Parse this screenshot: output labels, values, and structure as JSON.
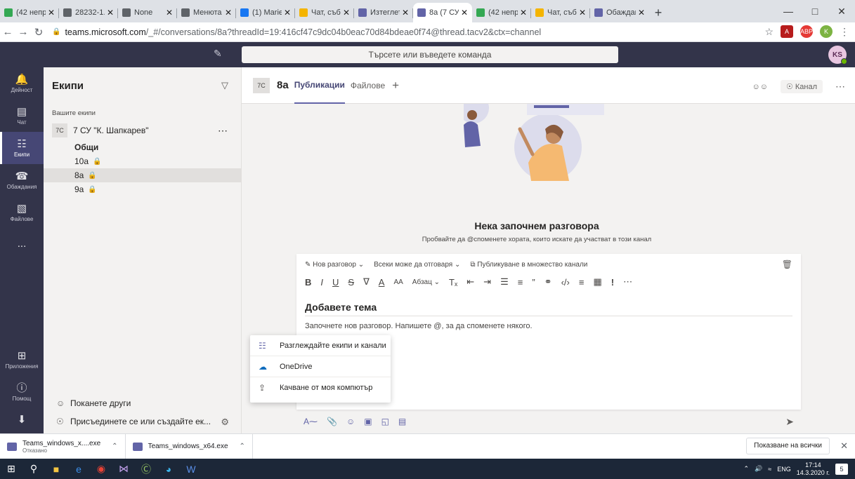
{
  "browser": {
    "tabs": [
      {
        "title": "(42 непро",
        "favicon": "#34a853"
      },
      {
        "title": "28232-1.p",
        "favicon": "#5f6368"
      },
      {
        "title": "None",
        "favicon": "#5f6368"
      },
      {
        "title": "Менюта",
        "favicon": "#5f6368"
      },
      {
        "title": "(1) Mariel",
        "favicon": "#1877f2"
      },
      {
        "title": "Чат, събр",
        "favicon": "#f4b400"
      },
      {
        "title": "Изтеглете",
        "favicon": "#6264a7"
      },
      {
        "title": "8a (7 СУ",
        "favicon": "#6264a7"
      },
      {
        "title": "(42 непро",
        "favicon": "#34a853"
      },
      {
        "title": "Чат, събр",
        "favicon": "#f4b400"
      },
      {
        "title": "Обаждан",
        "favicon": "#6264a7"
      }
    ],
    "active_tab": 7,
    "url_host": "teams.microsoft.com",
    "url_rest": "/_#/conversations/8a?threadId=19:416cf47c9dc04b0eac70d84bdeae0f74@thread.tacv2&ctx=channel",
    "extension_initial": "K"
  },
  "teams": {
    "search_placeholder": "Търсете или въведете команда",
    "user_initials": "KS",
    "rail": [
      {
        "label": "Дейност",
        "icon": "bell-icon"
      },
      {
        "label": "Чат",
        "icon": "chat-icon"
      },
      {
        "label": "Екипи",
        "icon": "teams-icon",
        "active": true
      },
      {
        "label": "Обаждания",
        "icon": "phone-icon"
      },
      {
        "label": "Файлове",
        "icon": "file-icon"
      }
    ],
    "rail_more": "...",
    "rail_apps": "Приложения",
    "rail_help": "Помощ",
    "panel": {
      "title": "Екипи",
      "section": "Вашите екипи",
      "team_badge": "7C",
      "team_name": "7 СУ \"К. Шапкарев\"",
      "channels": [
        {
          "name": "Общи",
          "bold": true,
          "locked": false
        },
        {
          "name": "10а",
          "bold": false,
          "locked": true
        },
        {
          "name": "8а",
          "bold": false,
          "locked": true,
          "selected": true
        },
        {
          "name": "9а",
          "bold": false,
          "locked": true
        }
      ],
      "invite": "Поканете други",
      "join": "Присъединете се или създайте ек..."
    },
    "main": {
      "badge": "7C",
      "channel": "8а",
      "tabs": [
        "Публикации",
        "Файлове"
      ],
      "channel_chip": "Канал",
      "welcome_title": "Нека започнем разговора",
      "welcome_sub": "Пробвайте да @споменете хората, които искате да участват в този канал",
      "editor": {
        "opt_new": "Нов разговор",
        "opt_reply": "Всеки може да отговаря",
        "opt_publish": "Публикуване в множество канали",
        "paragraph": "Абзац",
        "subject_placeholder": "Добавете тема",
        "body_placeholder": "Започнете нов разговор. Напишете @, за да споменете някого."
      },
      "attach_menu": [
        {
          "label": "Разглеждайте екипи и канали",
          "icon": "teams-icon"
        },
        {
          "label": "OneDrive",
          "icon": "onedrive-icon"
        },
        {
          "label": "Качване от моя компютър",
          "icon": "upload-icon"
        }
      ]
    }
  },
  "downloads": {
    "items": [
      {
        "name": "Teams_windows_x....exe",
        "status": "Отказано"
      },
      {
        "name": "Teams_windows_x64.exe",
        "status": ""
      }
    ],
    "show_all": "Показване на всички"
  },
  "taskbar": {
    "lang": "ENG",
    "time": "17:14",
    "date": "14.3.2020 г.",
    "notifications": "5"
  },
  "colors": {
    "teams_dark": "#33344a",
    "teams_purple": "#6264a7",
    "panel_bg": "#f3f2f1"
  }
}
